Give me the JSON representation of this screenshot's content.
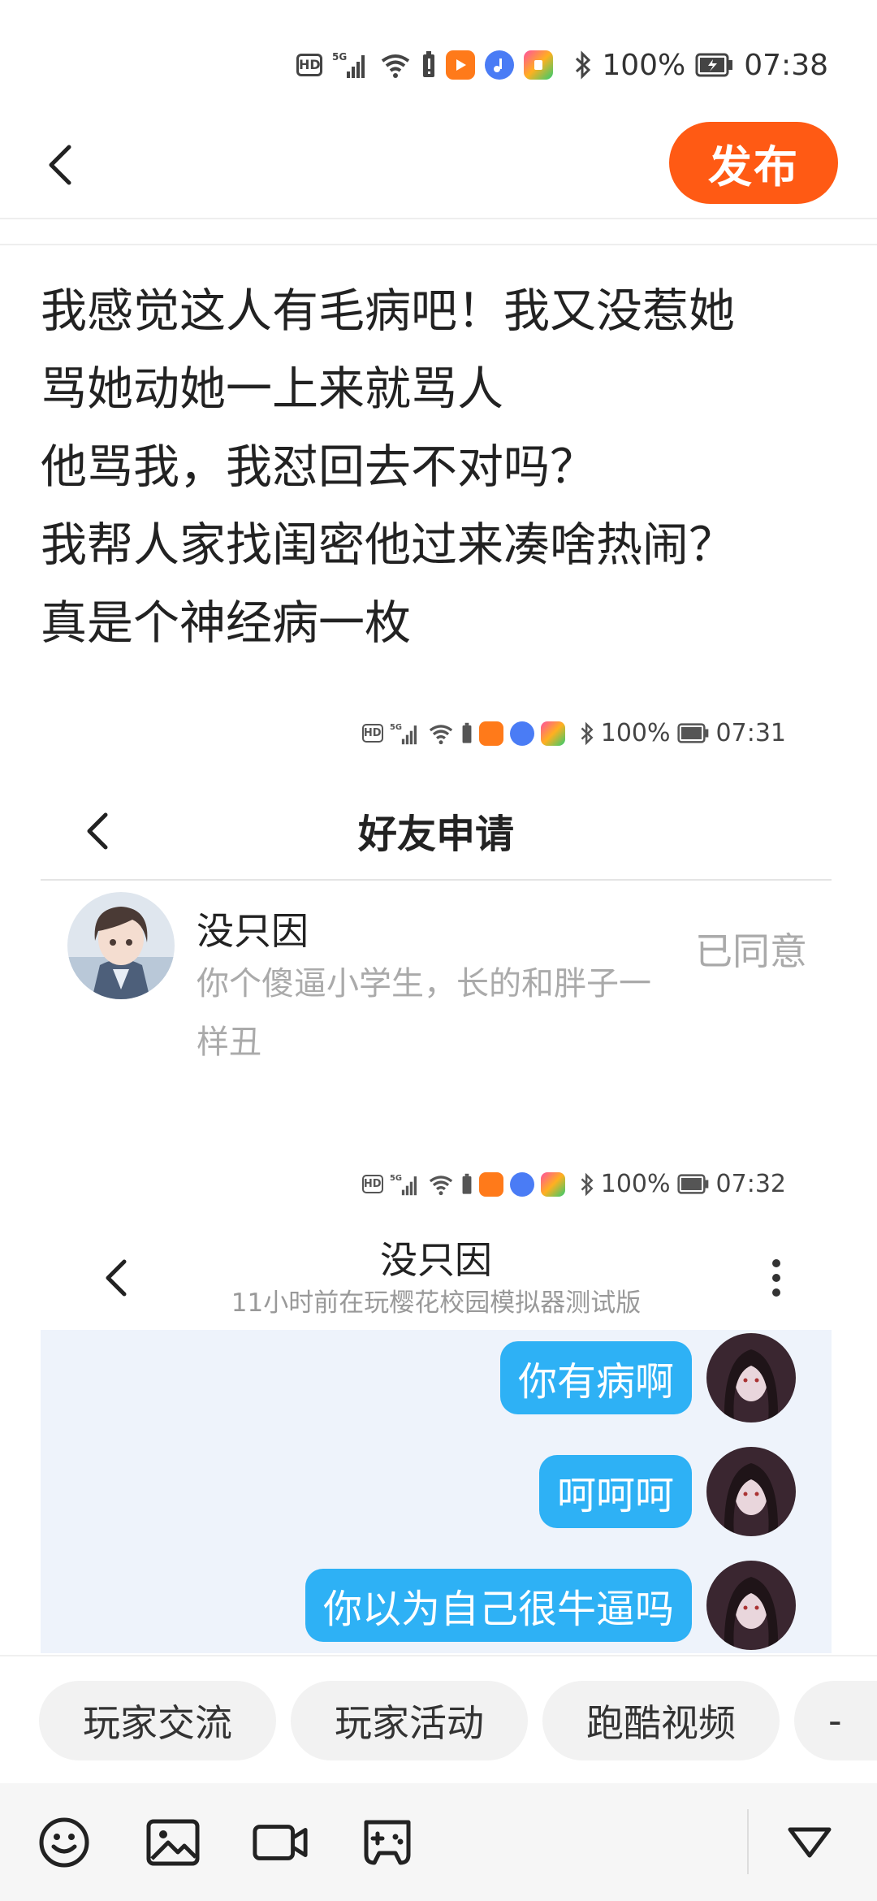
{
  "status_bar": {
    "hd": "HD",
    "network": "5G",
    "battery_percent": "100%",
    "time": "07:38"
  },
  "header": {
    "publish_label": "发布"
  },
  "post": {
    "lines": [
      "我感觉这人有毛病吧！我又没惹她",
      "骂她动她一上来就骂人",
      "他骂我，我怼回去不对吗？",
      "我帮人家找闺密他过来凑啥热闹？",
      "真是个神经病一枚"
    ]
  },
  "screenshot1": {
    "status": {
      "hd": "HD",
      "network": "5G",
      "battery_percent": "100%",
      "time": "07:31"
    },
    "title": "好友申请",
    "request": {
      "name": "没只因",
      "message": "你个傻逼小学生，长的和胖子一样丑",
      "status": "已同意"
    }
  },
  "screenshot2": {
    "status": {
      "hd": "HD",
      "network": "5G",
      "battery_percent": "100%",
      "time": "07:32"
    },
    "chat_name": "没只因",
    "chat_subtitle": "11小时前在玩樱花校园模拟器测试版",
    "messages": [
      {
        "text": "你有病啊"
      },
      {
        "text": "呵呵呵"
      },
      {
        "text": "你以为自己很牛逼吗"
      }
    ],
    "bubble_color": "#2eb1f5"
  },
  "tags": [
    {
      "label": "玩家交流"
    },
    {
      "label": "玩家活动"
    },
    {
      "label": "跑酷视频"
    },
    {
      "label": "-"
    }
  ],
  "toolbar": {
    "icons": [
      "emoji-icon",
      "image-icon",
      "video-icon",
      "gamepad-icon",
      "collapse-triangle-icon"
    ]
  },
  "colors": {
    "accent": "#ff5a14",
    "bubble": "#2eb1f5",
    "chat_bg": "#eef3fb"
  }
}
